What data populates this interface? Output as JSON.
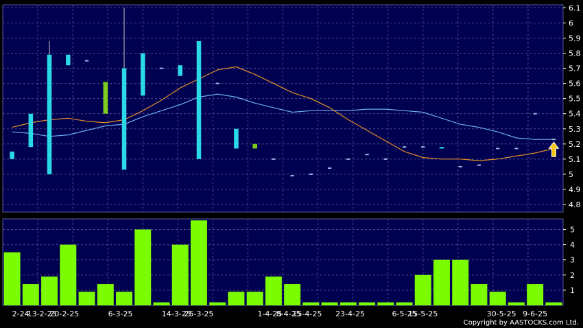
{
  "chart_data": [
    {
      "type": "candlestick",
      "title": "",
      "ylim": [
        4.75,
        6.12
      ],
      "y_ticks": [
        6.1,
        6,
        5.9,
        5.8,
        5.7,
        5.6,
        5.5,
        5.4,
        5.3,
        5.2,
        5.1,
        5,
        4.9,
        4.8
      ],
      "grid": true,
      "candles": [
        {
          "open": 5.15,
          "close": 5.1,
          "high": 5.15,
          "low": 5.1,
          "color": "cyan"
        },
        {
          "open": 5.18,
          "close": 5.4,
          "high": 5.4,
          "low": 5.18,
          "color": "cyan"
        },
        {
          "open": 5.79,
          "close": 5.0,
          "high": 5.88,
          "low": 5.0,
          "color": "cyan"
        },
        {
          "open": 5.79,
          "close": 5.72,
          "high": 5.79,
          "low": 5.72,
          "color": "cyan"
        },
        {
          "open": 5.75,
          "close": 5.75,
          "high": 5.75,
          "low": 5.75,
          "color": "cyan"
        },
        {
          "open": 5.4,
          "close": 5.61,
          "high": 5.61,
          "low": 5.4,
          "color": "green"
        },
        {
          "open": 5.7,
          "close": 5.03,
          "high": 6.1,
          "low": 5.03,
          "color": "cyan"
        },
        {
          "open": 5.8,
          "close": 5.52,
          "high": 5.8,
          "low": 5.52,
          "color": "cyan"
        },
        {
          "open": 5.7,
          "close": 5.7,
          "high": 5.7,
          "low": 5.7,
          "color": "cyan"
        },
        {
          "open": 5.72,
          "close": 5.65,
          "high": 5.72,
          "low": 5.65,
          "color": "cyan"
        },
        {
          "open": 5.88,
          "close": 5.1,
          "high": 5.88,
          "low": 5.1,
          "color": "cyan"
        },
        {
          "open": 5.6,
          "close": 5.6,
          "high": 5.6,
          "low": 5.6,
          "color": "cyan"
        },
        {
          "open": 5.3,
          "close": 5.17,
          "high": 5.3,
          "low": 5.17,
          "color": "cyan"
        },
        {
          "open": 5.17,
          "close": 5.2,
          "high": 5.2,
          "low": 5.17,
          "color": "green"
        },
        {
          "open": 5.1,
          "close": 5.1,
          "high": 5.1,
          "low": 5.1,
          "color": "cyan"
        },
        {
          "open": 4.99,
          "close": 4.99,
          "high": 4.99,
          "low": 4.99,
          "color": "cyan"
        },
        {
          "open": 5.0,
          "close": 5.0,
          "high": 5.0,
          "low": 5.0,
          "color": "cyan"
        },
        {
          "open": 5.04,
          "close": 5.04,
          "high": 5.04,
          "low": 5.04,
          "color": "cyan"
        },
        {
          "open": 5.1,
          "close": 5.1,
          "high": 5.1,
          "low": 5.1,
          "color": "cyan"
        },
        {
          "open": 5.13,
          "close": 5.13,
          "high": 5.13,
          "low": 5.13,
          "color": "cyan"
        },
        {
          "open": 5.1,
          "close": 5.1,
          "high": 5.1,
          "low": 5.1,
          "color": "cyan"
        },
        {
          "open": 5.18,
          "close": 5.18,
          "high": 5.18,
          "low": 5.18,
          "color": "cyan"
        },
        {
          "open": 5.18,
          "close": 5.18,
          "high": 5.18,
          "low": 5.18,
          "color": "cyan"
        },
        {
          "open": 5.18,
          "close": 5.17,
          "high": 5.18,
          "low": 5.17,
          "color": "cyan"
        },
        {
          "open": 5.05,
          "close": 5.05,
          "high": 5.05,
          "low": 5.05,
          "color": "cyan"
        },
        {
          "open": 5.06,
          "close": 5.06,
          "high": 5.06,
          "low": 5.06,
          "color": "cyan"
        },
        {
          "open": 5.17,
          "close": 5.17,
          "high": 5.17,
          "low": 5.17,
          "color": "cyan"
        },
        {
          "open": 5.17,
          "close": 5.17,
          "high": 5.17,
          "low": 5.17,
          "color": "cyan"
        },
        {
          "open": 5.4,
          "close": 5.4,
          "high": 5.4,
          "low": 5.4,
          "color": "cyan"
        },
        {
          "open": 5.23,
          "close": 5.23,
          "high": 5.23,
          "low": 5.23,
          "color": "cyan"
        }
      ],
      "series": [
        {
          "color": "#6ab0f0",
          "values": [
            5.28,
            5.27,
            5.25,
            5.26,
            5.29,
            5.32,
            5.33,
            5.38,
            5.42,
            5.46,
            5.51,
            5.53,
            5.51,
            5.47,
            5.44,
            5.41,
            5.42,
            5.42,
            5.42,
            5.43,
            5.43,
            5.42,
            5.41,
            5.37,
            5.33,
            5.31,
            5.28,
            5.24,
            5.23,
            5.23
          ]
        },
        {
          "color": "#e8902a",
          "values": [
            5.31,
            5.34,
            5.36,
            5.37,
            5.35,
            5.34,
            5.36,
            5.42,
            5.49,
            5.57,
            5.63,
            5.69,
            5.71,
            5.66,
            5.6,
            5.54,
            5.5,
            5.44,
            5.36,
            5.29,
            5.22,
            5.15,
            5.11,
            5.1,
            5.1,
            5.09,
            5.1,
            5.12,
            5.14,
            5.17
          ]
        }
      ]
    },
    {
      "type": "bar",
      "title": "",
      "ylim": [
        0,
        5.7
      ],
      "y_ticks": [
        5,
        4,
        3,
        2,
        1
      ],
      "grid": true,
      "color": "#7cfc00",
      "values": [
        3.5,
        1.4,
        1.9,
        4.0,
        0.9,
        1.4,
        0.9,
        5.0,
        0.2,
        4.0,
        5.6,
        0.2,
        0.9,
        0.9,
        1.9,
        1.4,
        0.2,
        0.2,
        0.2,
        0.2,
        0.2,
        0.2,
        2.0,
        3.0,
        3.0,
        1.4,
        0.9,
        0.2,
        1.4,
        0.2
      ]
    }
  ],
  "x_tick_labels": [
    {
      "label": "2-24",
      "index": 0
    },
    {
      "label": "13-2-25",
      "index": 1.6
    },
    {
      "label": "20-2-25",
      "index": 2.8
    },
    {
      "label": "6-3-25",
      "index": 5.8
    },
    {
      "label": "14-3-25",
      "index": 8.8
    },
    {
      "label": "25-3-25",
      "index": 10.0
    },
    {
      "label": "1-4-25",
      "index": 13.8
    },
    {
      "label": "8-4-25",
      "index": 14.8
    },
    {
      "label": "15-4-25",
      "index": 15.8
    },
    {
      "label": "23-4-25",
      "index": 18.1
    },
    {
      "label": "6-5-25",
      "index": 21.0
    },
    {
      "label": "15-5-25",
      "index": 22.0
    },
    {
      "label": "30-5-25",
      "index": 26.2
    },
    {
      "label": "9-6-25",
      "index": 28.0
    }
  ],
  "arrow_index": 29,
  "copyright": "Copyright by AASTOCKS.com Ltd."
}
